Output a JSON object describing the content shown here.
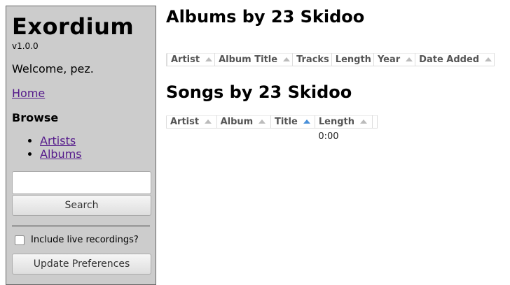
{
  "sidebar": {
    "app_title": "Exordium",
    "version": "v1.0.0",
    "welcome": "Welcome, pez.",
    "home_link": "Home",
    "browse_heading": "Browse",
    "browse_items": [
      {
        "label": "Artists"
      },
      {
        "label": "Albums"
      }
    ],
    "search": {
      "value": "",
      "button_label": "Search"
    },
    "live_checkbox": {
      "label": "Include live recordings?",
      "checked": false
    },
    "update_button": "Update Preferences"
  },
  "main": {
    "albums_title": "Albums by 23 Skidoo",
    "albums_columns": [
      "Artist",
      "Album Title",
      "Tracks",
      "Length",
      "Year",
      "Date Added"
    ],
    "songs_title": "Songs by 23 Skidoo",
    "songs_columns": [
      "Artist",
      "Album",
      "Title",
      "Length"
    ],
    "songs_rows": [
      {
        "artist": "",
        "album": "",
        "title": "",
        "length": "0:00"
      }
    ],
    "sorted_column": "Title"
  },
  "colors": {
    "sidebar_bg": "#cccccc",
    "link": "#551a8b",
    "sort_active": "#4a90d9"
  }
}
